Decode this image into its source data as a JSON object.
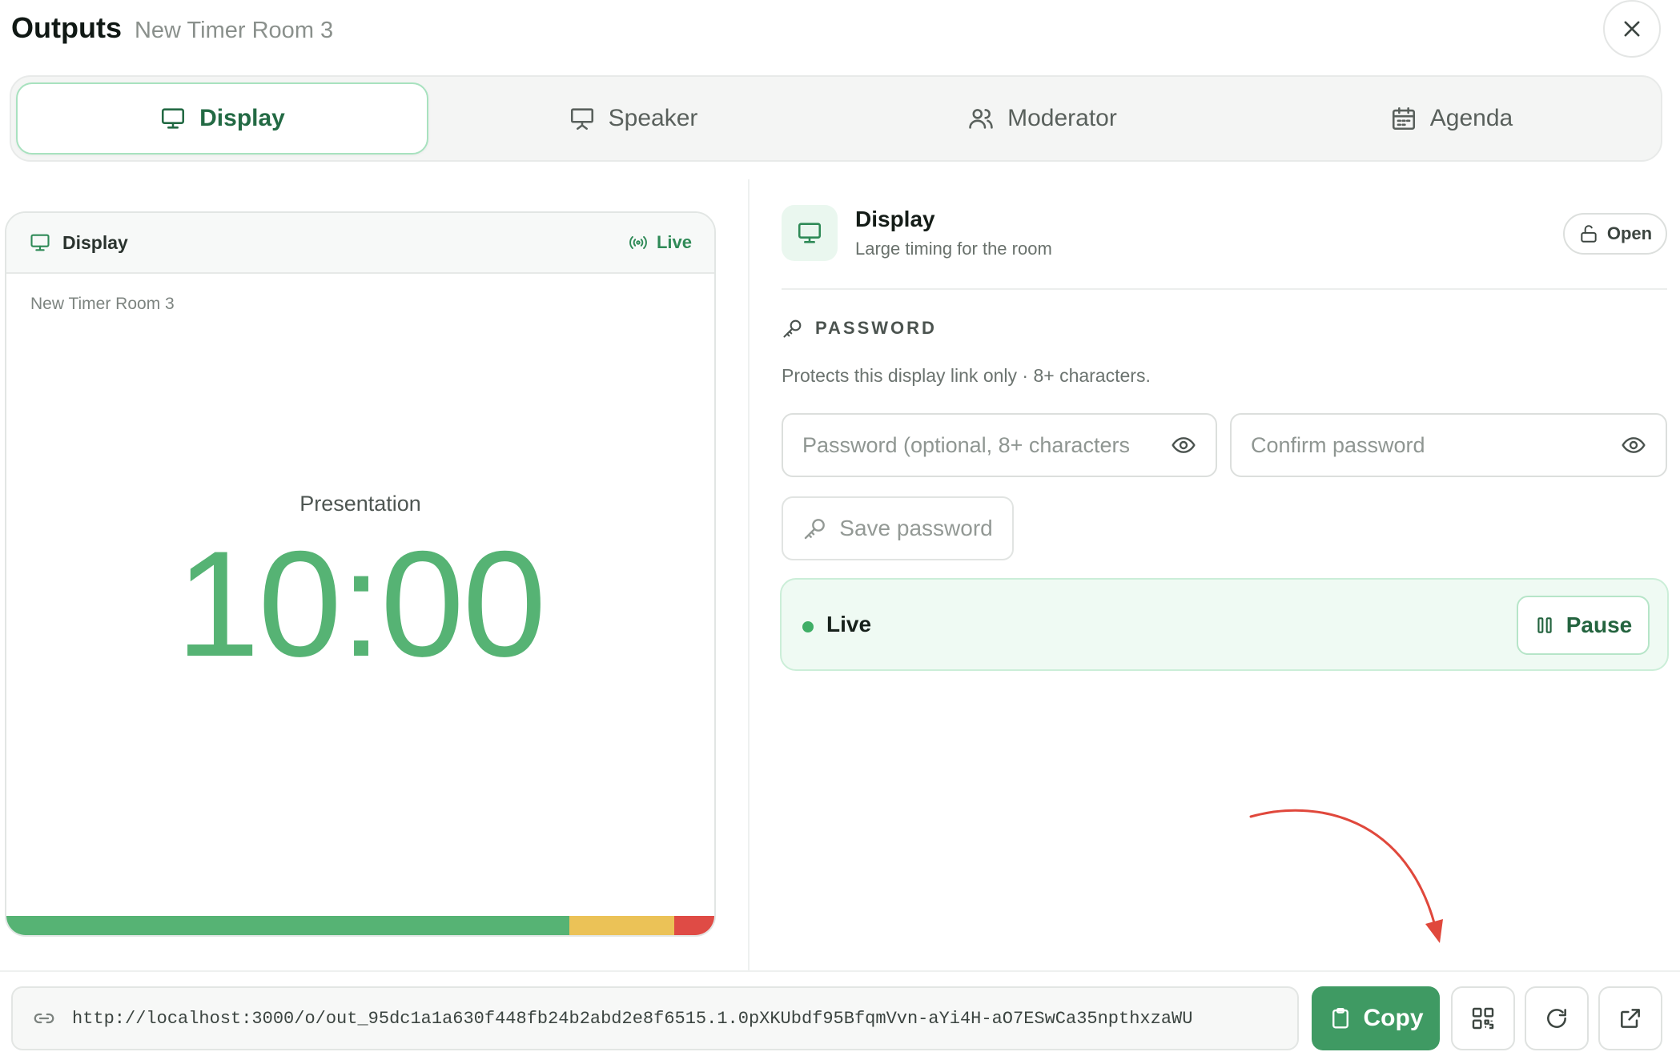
{
  "header": {
    "title": "Outputs",
    "room_name": "New Timer Room 3"
  },
  "tabs": [
    {
      "label": "Display",
      "icon": "monitor-icon",
      "active": true
    },
    {
      "label": "Speaker",
      "icon": "presentation-icon",
      "active": false
    },
    {
      "label": "Moderator",
      "icon": "users-icon",
      "active": false
    },
    {
      "label": "Agenda",
      "icon": "calendar-icon",
      "active": false
    }
  ],
  "preview": {
    "header_label": "Display",
    "live_label": "Live",
    "room_name": "New Timer Room 3",
    "segment_title": "Presentation",
    "timer": "10:00",
    "progress": {
      "green": 0.795,
      "yellow": 0.148,
      "red": 0.057
    }
  },
  "detail": {
    "title": "Display",
    "description": "Large timing for the room",
    "open_label": "Open"
  },
  "password": {
    "section_label": "PASSWORD",
    "description": "Protects this display link only · 8+ characters.",
    "password_placeholder": "Password (optional, 8+ characters",
    "password_value": "",
    "confirm_placeholder": "Confirm password",
    "confirm_value": "",
    "save_label": "Save password"
  },
  "status": {
    "live_label": "Live",
    "pause_label": "Pause"
  },
  "footer": {
    "url": "http://localhost:3000/o/out_95dc1a1a630f448fb24b2abd2e8f6515.1.0pXKUbdf95BfqmVvn-aYi4H-aO7ESwCa35npthxzaWU",
    "copy_label": "Copy"
  },
  "colors": {
    "accent_green": "#3f9a63",
    "timer_green": "#56b374",
    "warning_yellow": "#ebc257",
    "danger_red": "#df4b45",
    "annotation_arrow": "#e0483c"
  }
}
